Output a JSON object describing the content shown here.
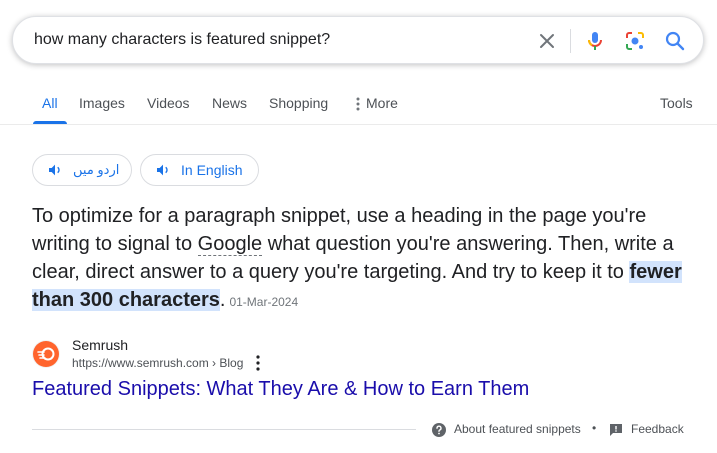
{
  "search": {
    "query": "how many characters is featured snippet?"
  },
  "tabs": [
    {
      "label": "All",
      "active": true
    },
    {
      "label": "Images"
    },
    {
      "label": "Videos"
    },
    {
      "label": "News"
    },
    {
      "label": "Shopping"
    },
    {
      "label": "More"
    }
  ],
  "tools_label": "Tools",
  "language_chips": {
    "urdu": "اردو میں",
    "english": "In English"
  },
  "answer": {
    "part1": "To optimize for a paragraph snippet, use a heading in the page you're writing to signal to ",
    "google_word": "Google",
    "part2": " what question you're answering. Then, write a clear, direct answer to a query you're targeting. And try to keep it to ",
    "highlight": "fewer than 300 characters",
    "period": ".",
    "date": "01-Mar-2024"
  },
  "source": {
    "name": "Semrush",
    "url": "https://www.semrush.com › Blog",
    "title": "Featured Snippets: What They Are & How to Earn Them"
  },
  "footer": {
    "about": "About featured snippets",
    "bullet": "•",
    "feedback": "Feedback"
  },
  "colors": {
    "accent": "#1a73e8",
    "link": "#1a0dab",
    "highlight_bg": "#d2e3fc",
    "semrush_orange": "#ff642d"
  }
}
